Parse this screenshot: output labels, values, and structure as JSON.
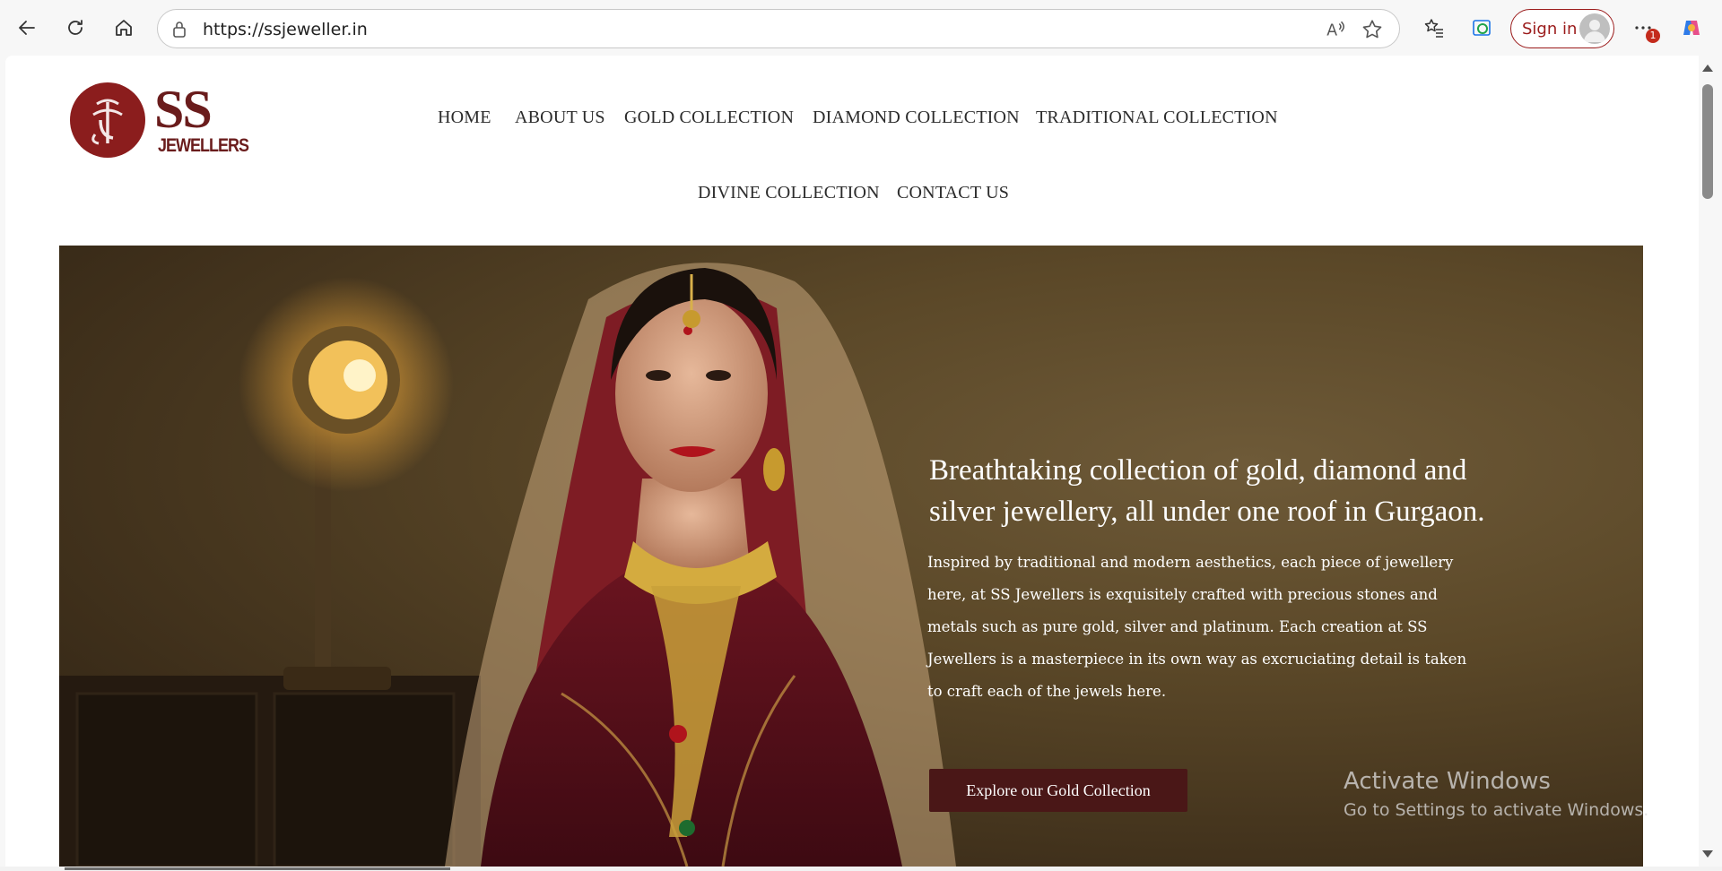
{
  "browser": {
    "url": "https://ssjeweller.in",
    "signin_label": "Sign in",
    "notification_count": "1",
    "icons": [
      "back-icon",
      "refresh-icon",
      "home-icon",
      "lock-icon",
      "read-aloud-icon",
      "favorite-star-icon",
      "favorites-icon",
      "browser-essentials-icon",
      "profile-avatar-icon",
      "more-icon",
      "copilot-icon"
    ]
  },
  "site": {
    "logo_letters": "SS",
    "logo_subtext": "JEWELLERS",
    "nav": {
      "home": "HOME",
      "about": "ABOUT US",
      "gold": "GOLD COLLECTION",
      "diamond": "DIAMOND COLLECTION",
      "traditional": "TRADITIONAL COLLECTION",
      "divine": "DIVINE COLLECTION",
      "contact": "CONTACT US"
    },
    "hero": {
      "title": "Breathtaking collection of gold, diamond and silver jewellery, all under one roof in Gurgaon.",
      "body": "Inspired by traditional and modern aesthetics, each piece of jewellery here, at SS Jewellers is exquisitely crafted with precious stones and metals such as pure gold, silver and platinum. Each creation at SS Jewellers is a masterpiece in its own way as excruciating detail is taken to craft each of the jewels here.",
      "cta": "Explore our Gold Collection"
    },
    "colors": {
      "brand": "#8b1d1d",
      "cta_bg": "#4a1717",
      "nav_text": "#2b2b2b"
    }
  },
  "os_watermark": {
    "line1": "Activate Windows",
    "line2": "Go to Settings to activate Windows."
  }
}
